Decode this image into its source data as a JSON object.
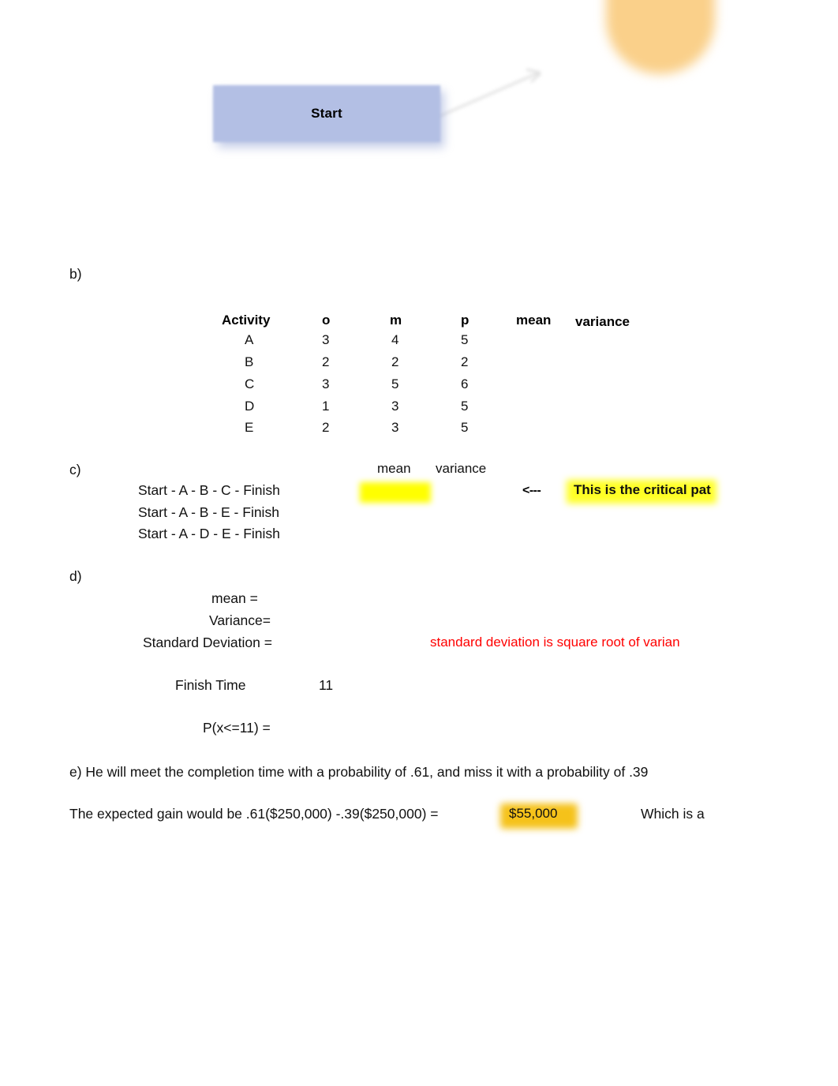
{
  "diagram": {
    "start_node_label": "Start",
    "node_fill_color": "#b3bfe4",
    "blob_color": "#fad08a",
    "connector_color": "#c9c9c9"
  },
  "sections": {
    "b": {
      "label": "b)"
    },
    "c": {
      "label": "c)",
      "mean_header": "mean",
      "variance_header": "variance",
      "arrow": "<---",
      "critical_path_note": "This is the critical pat",
      "highlight_color": "#ffff00",
      "paths": [
        "Start - A - B - C - Finish",
        "Start - A - B - E - Finish",
        "Start - A - D - E - Finish"
      ]
    },
    "d": {
      "label": "d)",
      "mean_label": "mean =",
      "variance_label": "Variance=",
      "std_dev_label": "Standard Deviation =",
      "red_note": "standard deviation is square root of varian",
      "red_note_color": "#ff0000",
      "finish_time_label": "Finish Time",
      "finish_time_value": "11",
      "probability_label": "P(x<=11) ="
    },
    "e": {
      "line1": "e) He will meet the completion time with a probability of .61, and miss it with a probability of .39",
      "line2_prefix": "The expected gain would be .61($250,000) -.39($250,000) =",
      "expected_gain_value": "$55,000",
      "expected_gain_highlight_color": "#f5c21a",
      "line2_suffix": "Which is a"
    }
  },
  "activity_table": {
    "columns": [
      "Activity",
      "o",
      "m",
      "p",
      "mean",
      "variance"
    ],
    "rows": [
      {
        "activity": "A",
        "o": "3",
        "m": "4",
        "p": "5",
        "mean": "",
        "variance": ""
      },
      {
        "activity": "B",
        "o": "2",
        "m": "2",
        "p": "2",
        "mean": "",
        "variance": ""
      },
      {
        "activity": "C",
        "o": "3",
        "m": "5",
        "p": "6",
        "mean": "",
        "variance": ""
      },
      {
        "activity": "D",
        "o": "1",
        "m": "3",
        "p": "5",
        "mean": "",
        "variance": ""
      },
      {
        "activity": "E",
        "o": "2",
        "m": "3",
        "p": "5",
        "mean": "",
        "variance": ""
      }
    ]
  }
}
